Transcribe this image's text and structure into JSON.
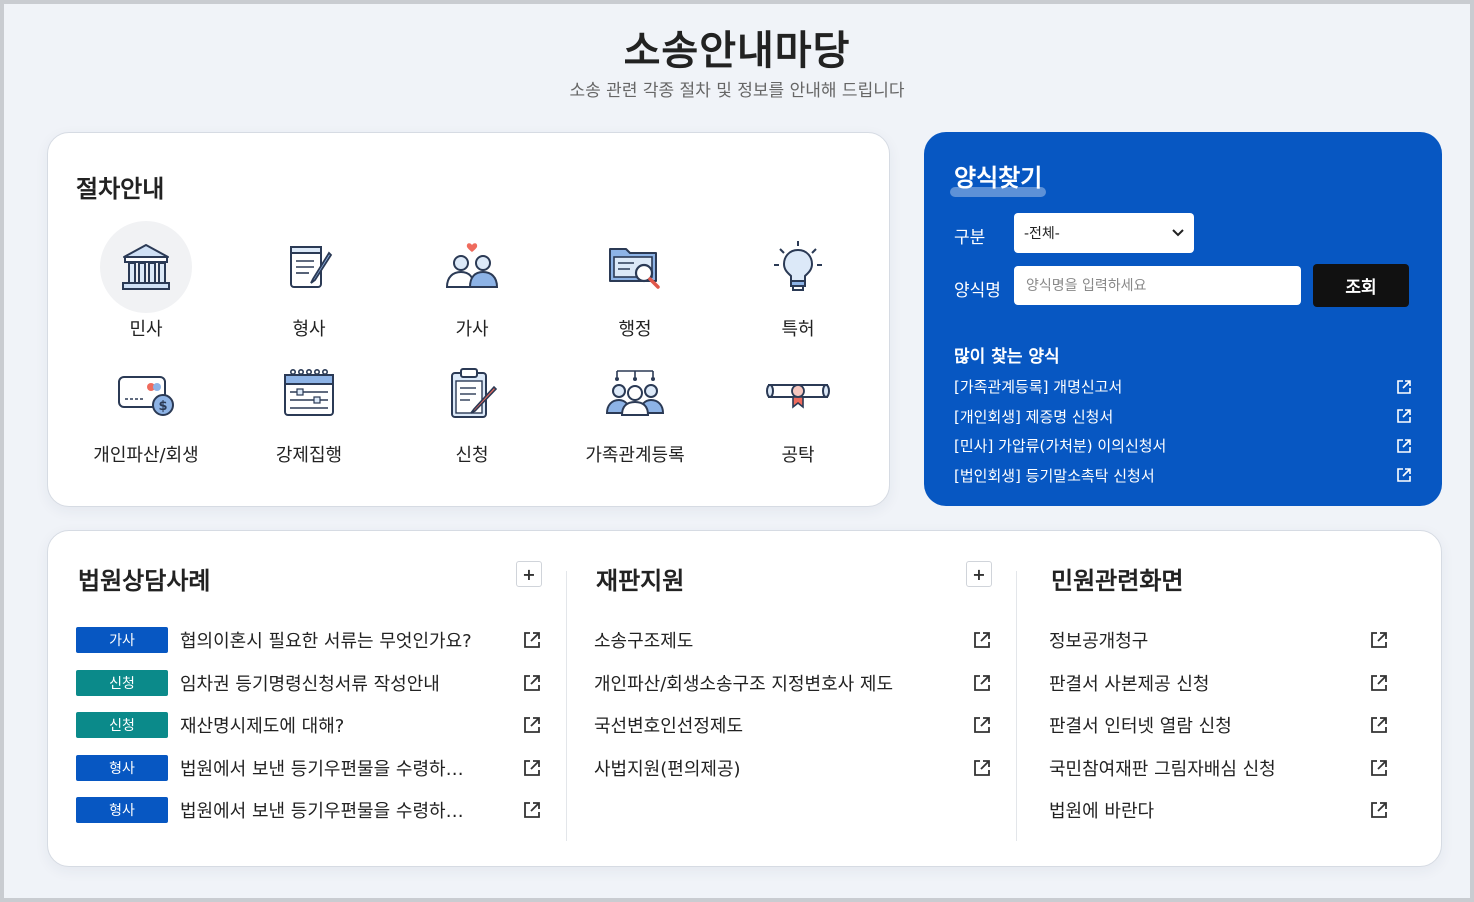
{
  "header": {
    "title": "소송안내마당",
    "subtitle": "소송 관련 각종 절차 및 정보를 안내해 드립니다"
  },
  "procedures": {
    "title": "절차안내",
    "items": [
      {
        "label": "민사",
        "icon": "courthouse-icon"
      },
      {
        "label": "형사",
        "icon": "document-quill-icon"
      },
      {
        "label": "가사",
        "icon": "couple-heart-icon"
      },
      {
        "label": "행정",
        "icon": "folder-search-icon"
      },
      {
        "label": "특허",
        "icon": "lightbulb-icon"
      },
      {
        "label": "개인파산/회생",
        "icon": "card-money-icon"
      },
      {
        "label": "강제집행",
        "icon": "calendar-icon"
      },
      {
        "label": "신청",
        "icon": "clipboard-pen-icon"
      },
      {
        "label": "가족관계등록",
        "icon": "family-group-icon"
      },
      {
        "label": "공탁",
        "icon": "scroll-seal-icon"
      }
    ]
  },
  "form_search": {
    "title": "양식찾기",
    "category_label": "구분",
    "category_value": "-전체-",
    "name_label": "양식명",
    "name_placeholder": "양식명을 입력하세요",
    "search_button": "조회",
    "popular_title": "많이 찾는 양식",
    "popular": [
      "[가족관계등록] 개명신고서",
      "[개인회생] 제증명 신청서",
      "[민사] 가압류(가처분) 이의신청서",
      "[법인회생] 등기말소촉탁 신청서"
    ]
  },
  "consult": {
    "title": "법원상담사례",
    "more": "+",
    "rows": [
      {
        "badge": "가사",
        "badge_color": "#0757c2",
        "text": "협의이혼시 필요한 서류는 무엇인가요?"
      },
      {
        "badge": "신청",
        "badge_color": "#0b8a8a",
        "text": "임차권 등기명령신청서류 작성안내"
      },
      {
        "badge": "신청",
        "badge_color": "#0b8a8a",
        "text": "재산명시제도에 대해?"
      },
      {
        "badge": "형사",
        "badge_color": "#0757c2",
        "text": "법원에서 보낸 등기우편물을 수령하…"
      },
      {
        "badge": "형사",
        "badge_color": "#0757c2",
        "text": "법원에서 보낸 등기우편물을 수령하…"
      }
    ]
  },
  "trial_support": {
    "title": "재판지원",
    "more": "+",
    "rows": [
      "소송구조제도",
      "개인파산/회생소송구조 지정변호사 제도",
      "국선변호인선정제도",
      "사법지원(편의제공)"
    ]
  },
  "civil": {
    "title": "민원관련화면",
    "rows": [
      "정보공개청구",
      "판결서 사본제공 신청",
      "판결서 인터넷 열람 신청",
      "국민참여재판 그림자배심 신청",
      "법원에 바란다"
    ]
  },
  "colors": {
    "primary_blue": "#0757c2",
    "teal": "#0b8a8a",
    "dark": "#111111"
  }
}
